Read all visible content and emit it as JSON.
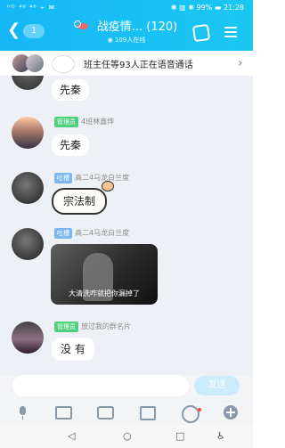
{
  "status": {
    "left": "ᴴᴰ ⁴⁶ ⁴⁶ ⌁ ✉",
    "right": "✱ ▥ ❋ 99% ▬ 21:28"
  },
  "header": {
    "back": "❮",
    "unread": "1",
    "title": "战疫情... (120)",
    "subtitle": "◉ 109人在线"
  },
  "voice_banner": {
    "text": "班主任等93人正在语音通话",
    "arrow": "›"
  },
  "messages": [
    {
      "text": "先秦"
    },
    {
      "tag": "管理员",
      "tag_color": "#4fd07d",
      "sender": "4班林鑫烨",
      "text": "先秦"
    },
    {
      "tag": "吐槽",
      "tag_color": "#7bb8f2",
      "sender": "高二4马龙白兰度",
      "text": "宗法制"
    },
    {
      "tag": "吐槽",
      "tag_color": "#7bb8f2",
      "sender": "高二4马龙白兰度",
      "image_caption": "大清洗咋就把你漏掉了"
    },
    {
      "tag": "管理员",
      "tag_color": "#4fd07d",
      "sender": "放过我的群名片",
      "text": "没 有"
    }
  ],
  "input": {
    "placeholder": "",
    "send": "发送"
  },
  "toolbar": {
    "icons": [
      "microphone-icon",
      "image-icon",
      "camera-icon",
      "gift-icon",
      "emoji-icon",
      "plus-icon"
    ]
  },
  "nav": {
    "back": "◁",
    "home": "○",
    "recent": "□",
    "accessibility": "♿"
  },
  "colors": {
    "header": "#17bdf3",
    "admin_tag": "#4fd07d",
    "tucao_tag": "#7bb8f2",
    "send_button": "#c9ebfb"
  }
}
